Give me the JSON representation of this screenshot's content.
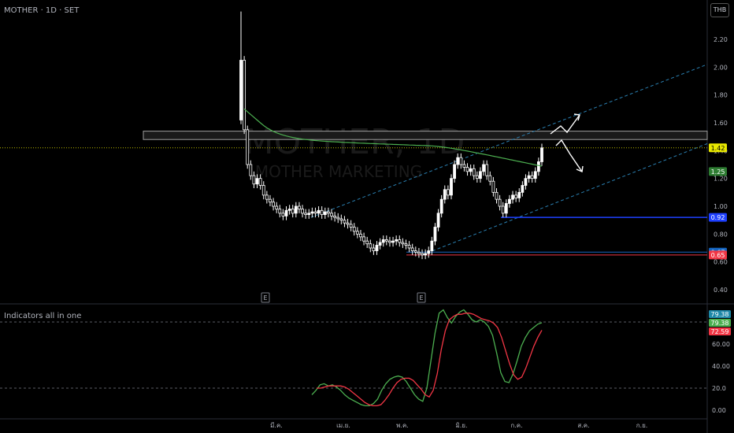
{
  "header": {
    "symbol_line": "MOTHER · 1D · SET",
    "currency": "THB",
    "watermark_main": "MOTHER, 1D",
    "watermark_sub": "MOTHER MARKETING"
  },
  "indicator_pane": {
    "title": "Indicators all in one"
  },
  "colors": {
    "background": "#000000",
    "up_candle": "#ffffff",
    "down_candle": "#ffffff",
    "ma_line": "#4caf50",
    "channel": "#2962ff",
    "support_line": "#1e40ff",
    "resistance_zone": "#9e9e9e",
    "stoch_k": "#4caf50",
    "stoch_d": "#f23645"
  },
  "chart_data": [
    {
      "type": "candlestick",
      "title": "MOTHER · 1D · SET",
      "y_axis": {
        "ticks": [
          "2.20",
          "2.00",
          "1.80",
          "1.60",
          "1.40",
          "1.20",
          "1.00",
          "0.80",
          "0.60",
          "0.40"
        ],
        "range": [
          0.28,
          2.4
        ],
        "scale": "linear"
      },
      "x_axis": {
        "ticks": [
          "มี.ค.",
          "เม.ย.",
          "พ.ค.",
          "มิ.ย.",
          "ก.ค.",
          "ส.ค.",
          "ก.ย."
        ]
      },
      "price_labels": [
        {
          "value": "1.42",
          "color": "#e8e800",
          "text_color": "#000"
        },
        {
          "value": "1.25",
          "color": "#2e7d32",
          "text_color": "#fff"
        },
        {
          "value": "0.92",
          "color": "#1e40ff",
          "text_color": "#fff"
        },
        {
          "value": "0.67",
          "color": "#1565c0",
          "text_color": "#fff"
        },
        {
          "value": "0.65",
          "color": "#f23645",
          "text_color": "#fff"
        }
      ],
      "current_price": 1.42,
      "moving_average_last": 1.25,
      "horizontal_levels": [
        0.92,
        0.67,
        0.65
      ],
      "resistance_zone": [
        1.48,
        1.54
      ],
      "earnings_markers": [
        "E",
        "E"
      ],
      "series_ohlc_close": [
        2.05,
        1.55,
        1.3,
        1.22,
        1.16,
        1.2,
        1.15,
        1.08,
        1.05,
        1.03,
        1.0,
        0.98,
        0.95,
        0.93,
        0.97,
        0.98,
        0.95,
        1.0,
        0.98,
        0.95,
        0.94,
        0.95,
        0.96,
        0.95,
        0.97,
        0.94,
        0.96,
        0.95,
        0.93,
        0.92,
        0.91,
        0.9,
        0.88,
        0.87,
        0.85,
        0.82,
        0.8,
        0.78,
        0.75,
        0.73,
        0.7,
        0.68,
        0.72,
        0.74,
        0.76,
        0.75,
        0.74,
        0.75,
        0.76,
        0.74,
        0.73,
        0.72,
        0.7,
        0.68,
        0.67,
        0.66,
        0.65,
        0.66,
        0.68,
        0.75,
        0.85,
        0.95,
        1.05,
        1.12,
        1.08,
        1.2,
        1.3,
        1.35,
        1.3,
        1.28,
        1.25,
        1.27,
        1.22,
        1.2,
        1.25,
        1.3,
        1.22,
        1.18,
        1.1,
        1.05,
        1.0,
        0.95,
        1.02,
        1.05,
        1.08,
        1.06,
        1.1,
        1.15,
        1.2,
        1.22,
        1.2,
        1.25,
        1.32,
        1.42
      ]
    },
    {
      "type": "line",
      "title": "Indicators all in one",
      "y_axis": {
        "ticks": [
          "60.00",
          "40.00",
          "20.0",
          "0.00"
        ],
        "range": [
          -5,
          95
        ]
      },
      "levels": [
        80,
        20
      ],
      "labels": [
        {
          "value": "79.38",
          "color": "#1e88a8"
        },
        {
          "value": "79.38",
          "color": "#4caf50"
        },
        {
          "value": "72.59",
          "color": "#f23645"
        }
      ],
      "series": [
        {
          "name": "%K",
          "values": [
            14,
            18,
            23,
            24,
            22,
            23,
            21,
            18,
            14,
            11,
            9,
            7,
            5,
            4,
            4,
            6,
            10,
            18,
            24,
            28,
            30,
            31,
            30,
            26,
            20,
            14,
            10,
            8,
            20,
            45,
            70,
            88,
            91,
            84,
            79,
            85,
            89,
            91,
            87,
            82,
            80,
            82,
            80,
            76,
            68,
            52,
            34,
            26,
            25,
            33,
            45,
            58,
            66,
            72,
            75,
            78,
            79.38
          ]
        },
        {
          "name": "%D",
          "values": [
            20,
            20,
            21,
            22,
            22,
            22,
            22,
            21,
            19,
            16,
            13,
            10,
            7,
            5,
            4,
            4,
            5,
            9,
            14,
            20,
            25,
            28,
            29,
            29,
            27,
            23,
            19,
            14,
            12,
            18,
            33,
            55,
            72,
            82,
            85,
            87,
            87,
            88,
            88,
            87,
            85,
            83,
            82,
            81,
            79,
            75,
            66,
            54,
            42,
            32,
            28,
            30,
            38,
            48,
            58,
            66,
            72.59
          ]
        }
      ]
    }
  ]
}
